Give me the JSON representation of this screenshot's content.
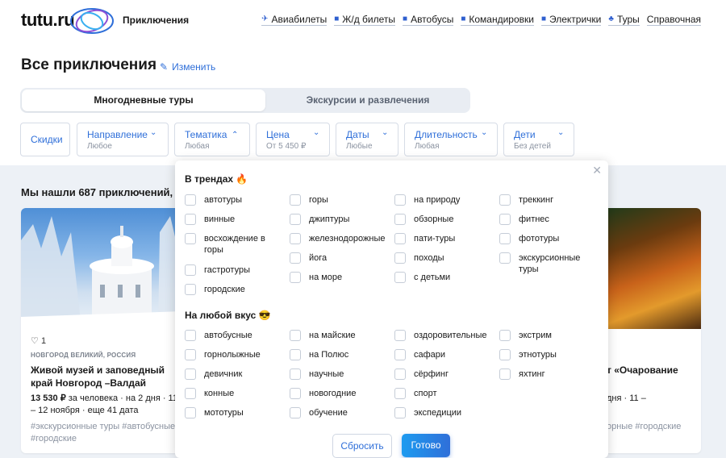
{
  "header": {
    "logo": "tutu.ru",
    "section": "Приключения",
    "nav": [
      {
        "label": "Авиабилеты",
        "icon": "plane-icon"
      },
      {
        "label": "Ж/д билеты",
        "icon": "train-icon"
      },
      {
        "label": "Автобусы",
        "icon": "bus-icon"
      },
      {
        "label": "Командировки",
        "icon": "briefcase-icon"
      },
      {
        "label": "Электрички",
        "icon": "suburban-train-icon"
      },
      {
        "label": "Туры",
        "icon": "palm-icon"
      },
      {
        "label": "Справочная",
        "icon": ""
      }
    ]
  },
  "page": {
    "title": "Все приключения",
    "edit_label": "Изменить"
  },
  "tabs": {
    "active": "Многодневные туры",
    "inactive": "Экскурсии и развлечения"
  },
  "filters": {
    "discounts": "Скидки",
    "direction": {
      "label": "Направление",
      "value": "Любое"
    },
    "theme": {
      "label": "Тематика",
      "value": "Любая"
    },
    "price": {
      "label": "Цена",
      "value": "От 5 450 ₽"
    },
    "dates": {
      "label": "Даты",
      "value": "Любые"
    },
    "duration": {
      "label": "Длительность",
      "value": "Любая"
    },
    "children": {
      "label": "Дети",
      "value": "Без детей"
    }
  },
  "results": {
    "found": "Мы нашли 687 приключений, с"
  },
  "card_left": {
    "likes": "1",
    "location": "НОВГОРОД ВЕЛИКИЙ, РОССИЯ",
    "title": "Живой музей и заповедный край Новгород –Валдай",
    "price": "13 530 ₽",
    "price_rest": " за человека · на 2 дня · 11 – 12 ноября · еще 41 дата",
    "tags": "#экскурсионные туры  #автобусные  #городские"
  },
  "card_right": {
    "title": "т «Очарование",
    "price_rest": "дня · 11 –",
    "tags": "орные  #городские"
  },
  "dropdown": {
    "trends_title": "В трендах 🔥",
    "any_taste_title": "На любой вкус 😎",
    "trends": [
      [
        "автотуры",
        "винные",
        "восхождение в горы",
        "гастротуры",
        "городские"
      ],
      [
        "горы",
        "джиптуры",
        "железнодорожные",
        "йога",
        "на море"
      ],
      [
        "на природу",
        "обзорные",
        "пати-туры",
        "походы",
        "с детьми"
      ],
      [
        "треккинг",
        "фитнес",
        "фототуры",
        "экскурсионные туры"
      ]
    ],
    "any_taste": [
      [
        "автобусные",
        "горнолыжные",
        "девичник",
        "конные",
        "мототуры"
      ],
      [
        "на майские",
        "на Полюс",
        "научные",
        "новогодние",
        "обучение"
      ],
      [
        "оздоровительные",
        "сафари",
        "сёрфинг",
        "спорт",
        "экспедиции"
      ],
      [
        "экстрим",
        "этнотуры",
        "яхтинг"
      ]
    ],
    "reset_label": "Сбросить",
    "done_label": "Готово"
  }
}
